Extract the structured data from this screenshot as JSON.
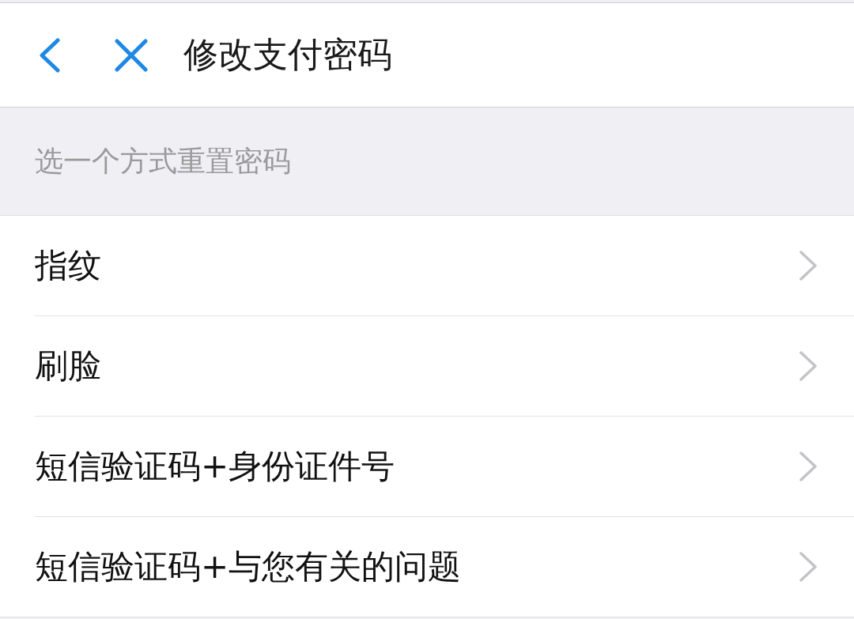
{
  "header": {
    "title": "修改支付密码"
  },
  "section": {
    "label": "选一个方式重置密码"
  },
  "options": [
    {
      "label": "指纹"
    },
    {
      "label": "刷脸"
    },
    {
      "label": "短信验证码+身份证件号"
    },
    {
      "label": "短信验证码+与您有关的问题"
    }
  ]
}
